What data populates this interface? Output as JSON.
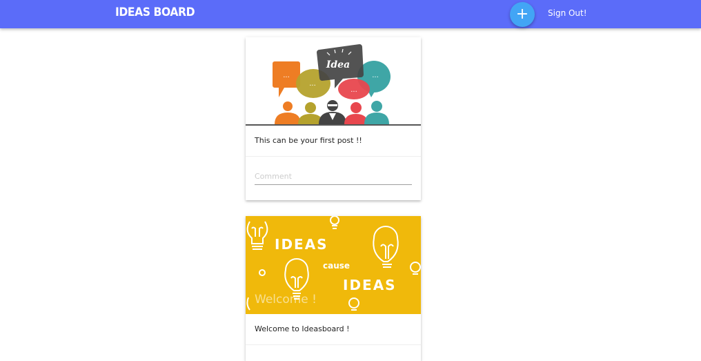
{
  "header": {
    "brand": "IDEAS BOARD",
    "add_label": "+",
    "signout_label": "Sign Out!"
  },
  "posts": [
    {
      "text": "This can be your first post !!",
      "comment_placeholder": "Comment",
      "image": {
        "speech_bubble_text": "Idea",
        "bubble_dots": "..."
      }
    },
    {
      "image_title": "Welcome !",
      "text": "Welcome to Ideasboard !",
      "image": {
        "line1": "IDEAS",
        "line2": "cause",
        "line3": "IDEAS"
      }
    }
  ],
  "colors": {
    "navbar": "#5b6cf9",
    "fab": "#42a5f5",
    "card2_image_bg": "#f0b90b"
  }
}
